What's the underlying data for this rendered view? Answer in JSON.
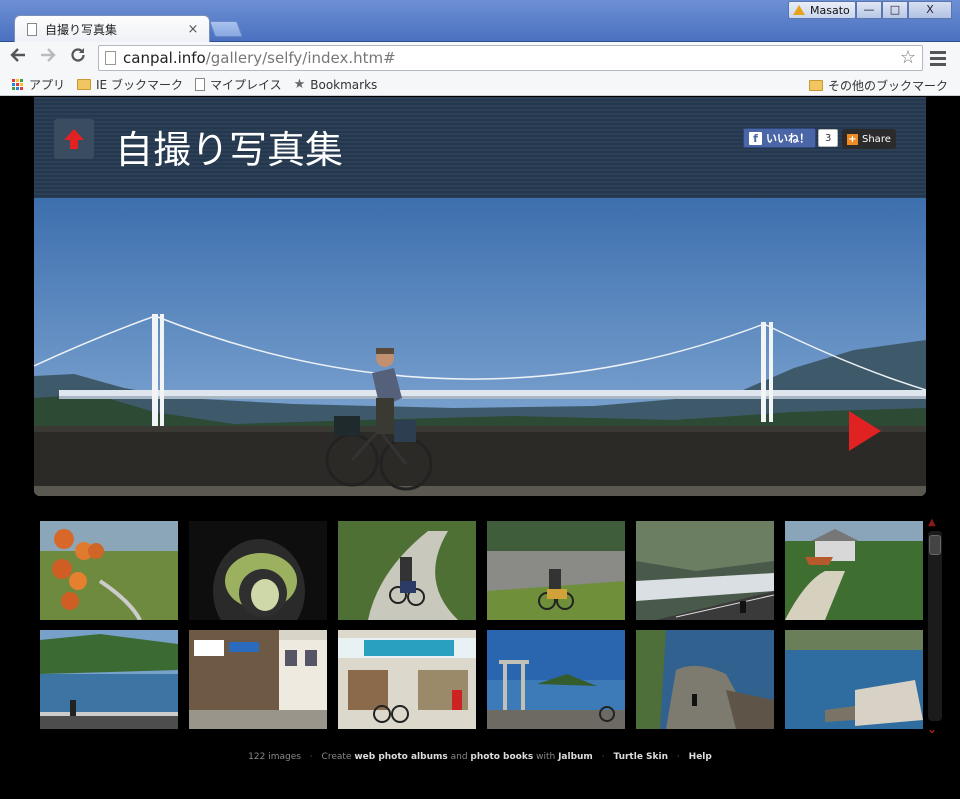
{
  "browser": {
    "tab_title": "自撮り写真集",
    "tab_close": "×",
    "user_name": "Masato",
    "window_buttons": [
      "—",
      "□",
      "X"
    ],
    "url_host": "canpal.info",
    "url_path": "/gallery/selfy/index.htm#",
    "icons": {
      "back": "back-arrow-icon",
      "forward": "forward-arrow-icon",
      "reload": "reload-icon",
      "star": "star-icon",
      "menu": "hamburger-menu-icon"
    }
  },
  "bookmarks": {
    "items": [
      {
        "label": "アプリ",
        "icon": "apps-grid-icon"
      },
      {
        "label": "IE ブックマーク",
        "icon": "folder-icon"
      },
      {
        "label": "マイプレイス",
        "icon": "page-icon"
      },
      {
        "label": "Bookmarks",
        "icon": "star-icon"
      }
    ],
    "right": {
      "label": "その他のブックマーク",
      "icon": "folder-icon"
    }
  },
  "gallery": {
    "title": "自撮り写真集",
    "like_label": "いいね！",
    "like_count": "3",
    "share_label": "Share"
  },
  "footer": {
    "count": "122 images",
    "create": "Create",
    "web_albums": "web photo albums",
    "and": "and",
    "photo_books": "photo books",
    "with": "with",
    "jalbum": "Jalbum",
    "skin": "Turtle Skin",
    "help": "Help"
  },
  "colors": {
    "accent_red": "#e02222",
    "header_bg": "#2b3f57",
    "titlebar": "#4a70c0"
  }
}
